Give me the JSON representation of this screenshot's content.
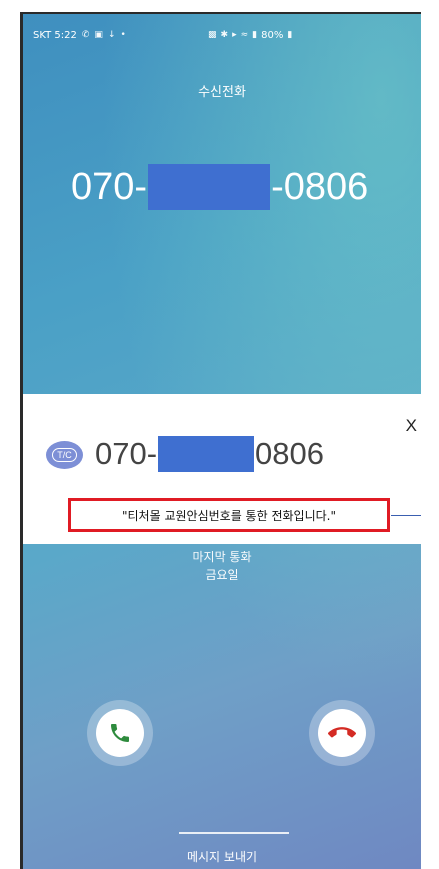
{
  "status_bar": {
    "carrier_time": "SKT 5:22",
    "battery": "80%"
  },
  "call": {
    "type_label": "수신전화",
    "number_prefix": "070-",
    "number_suffix": "-0806"
  },
  "popup": {
    "close_label": "X",
    "logo_text": "T/C",
    "number_prefix": "070-",
    "number_suffix": "0806",
    "notice": "\"티처몰 교원안심번호를 통한 전화입니다.\""
  },
  "caller_info": {
    "line1": "마지막 통화",
    "line2": "금요일"
  },
  "actions": {
    "accept_icon": "phone-accept-icon",
    "decline_icon": "phone-decline-icon",
    "message_label": "메시지 보내기"
  },
  "colors": {
    "accept": "#2e8b3d",
    "decline": "#d42b24",
    "redaction": "#3f6fd0",
    "highlight_border": "#e01b24"
  }
}
